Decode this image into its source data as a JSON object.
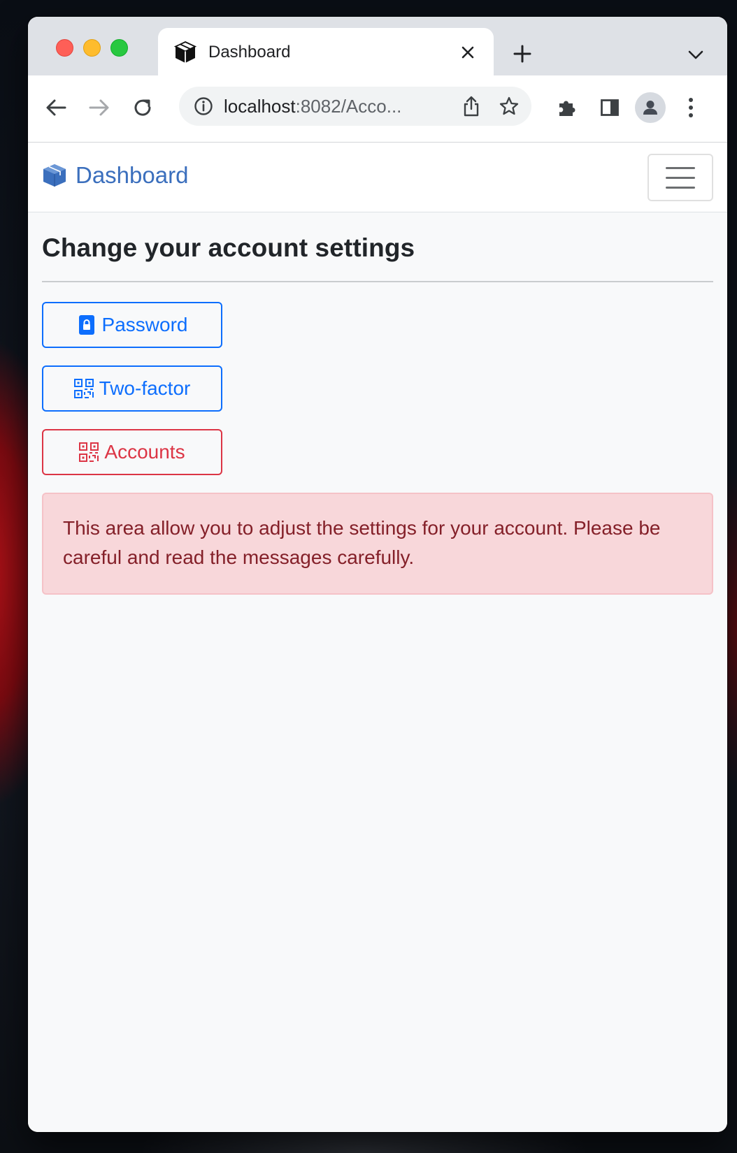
{
  "browser": {
    "tab": {
      "title": "Dashboard",
      "icon": "package-icon"
    },
    "url": {
      "host": "localhost",
      "rest": ":8082/Acco..."
    }
  },
  "navbar": {
    "brand": "Dashboard",
    "brand_color": "#3b6fbd"
  },
  "main": {
    "title": "Change your account settings",
    "buttons": [
      {
        "label": "Password",
        "icon": "lock-icon",
        "variant": "outline-primary"
      },
      {
        "label": "Two-factor",
        "icon": "qr-code-icon",
        "variant": "outline-primary"
      },
      {
        "label": "Accounts",
        "icon": "qr-code-icon",
        "variant": "outline-danger"
      }
    ],
    "alert": "This area allow you to adjust the settings for your account. Please be careful and read the messages carefully."
  },
  "colors": {
    "primary": "#0d6efd",
    "danger": "#dc3545",
    "alert_bg": "#f8d7da",
    "alert_text": "#842029"
  }
}
